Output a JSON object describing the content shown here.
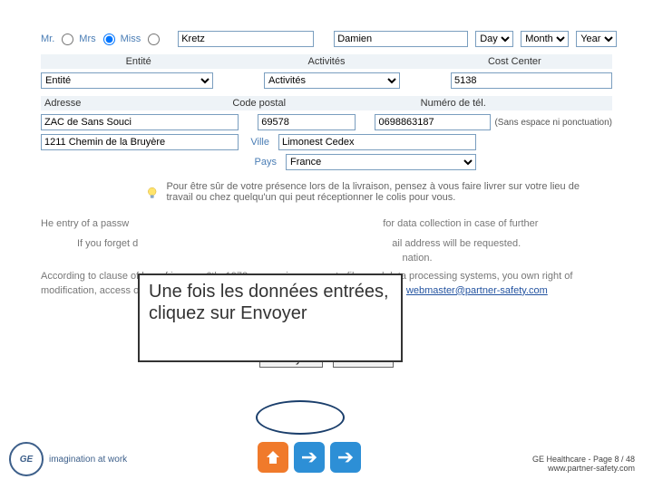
{
  "title_row": {
    "mr": "Mr.",
    "mrs": "Mrs",
    "miss": "Miss",
    "lastname": "Kretz",
    "firstname": "Damien",
    "day": "Day",
    "month": "Month",
    "year": "Year"
  },
  "section1": {
    "c1": "Entité",
    "c2": "Activités",
    "c3": "Cost Center"
  },
  "row1": {
    "entite": "Entité",
    "activites": "Activités",
    "costcenter": "5138"
  },
  "section2": {
    "c1": "Adresse",
    "c2": "Code postal",
    "c3": "Numéro de tél."
  },
  "addr1": "ZAC de Sans Souci",
  "addr2": "1211 Chemin de la Bruyère",
  "postal": "69578",
  "tel": "0698863187",
  "tel_hint": "(Sans espace ni ponctuation)",
  "ville_lbl": "Ville",
  "ville": "Limonest Cedex",
  "pays_lbl": "Pays",
  "pays": "France",
  "tip": "Pour être sûr de votre présence lors de la livraison, pensez à vous faire livrer sur votre lieu de travail ou chez quelqu'un qui peut réceptionner le colis pour vous.",
  "info1_a": "He entry of a passw",
  "info1_b": "for data collection in case of further",
  "info2_a": "If you forget d",
  "info2_b": "ail address will be requested.",
  "info2_c": "nation.",
  "info3": "According to clause of law of january 6th, 1978 concerning access to files and data processing systems, you own right of modification, access of removal of your datas you simply have to send a E-Mail to: ",
  "mail": "webmaster@partner-safety.com",
  "callout": "Une fois les données entrées, cliquez sur Envoyer",
  "btn_send": "Envoyer",
  "btn_cancel": "Annuler",
  "ge_tag": "imagination at work",
  "footer1": "GE Healthcare - Page 8 / 48",
  "footer2": "www.partner-safety.com"
}
